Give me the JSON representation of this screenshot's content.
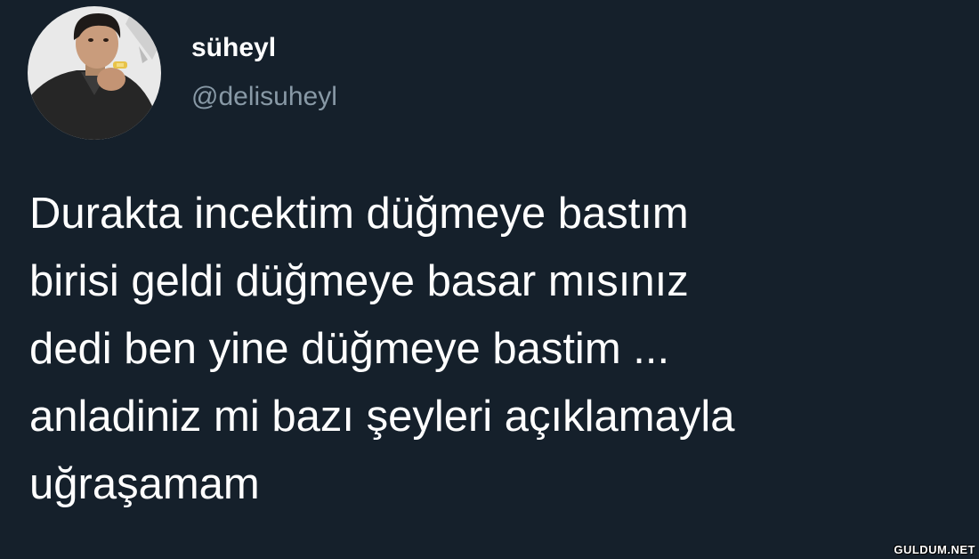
{
  "author": {
    "display_name": "süheyl",
    "handle": "@delisuheyl",
    "avatar": "profile-photo"
  },
  "tweet": {
    "lines": [
      "Durakta incektim düğmeye bastım",
      "birisi geldi düğmeye basar mısınız",
      "dedi ben yine düğmeye bastim ...",
      "anladiniz mi bazı şeyleri açıklamayla",
      "uğraşamam"
    ]
  },
  "watermark": "GULDUM.NET",
  "colors": {
    "background": "#15202b",
    "primary_text": "#ffffff",
    "secondary_text": "#8899a6"
  }
}
